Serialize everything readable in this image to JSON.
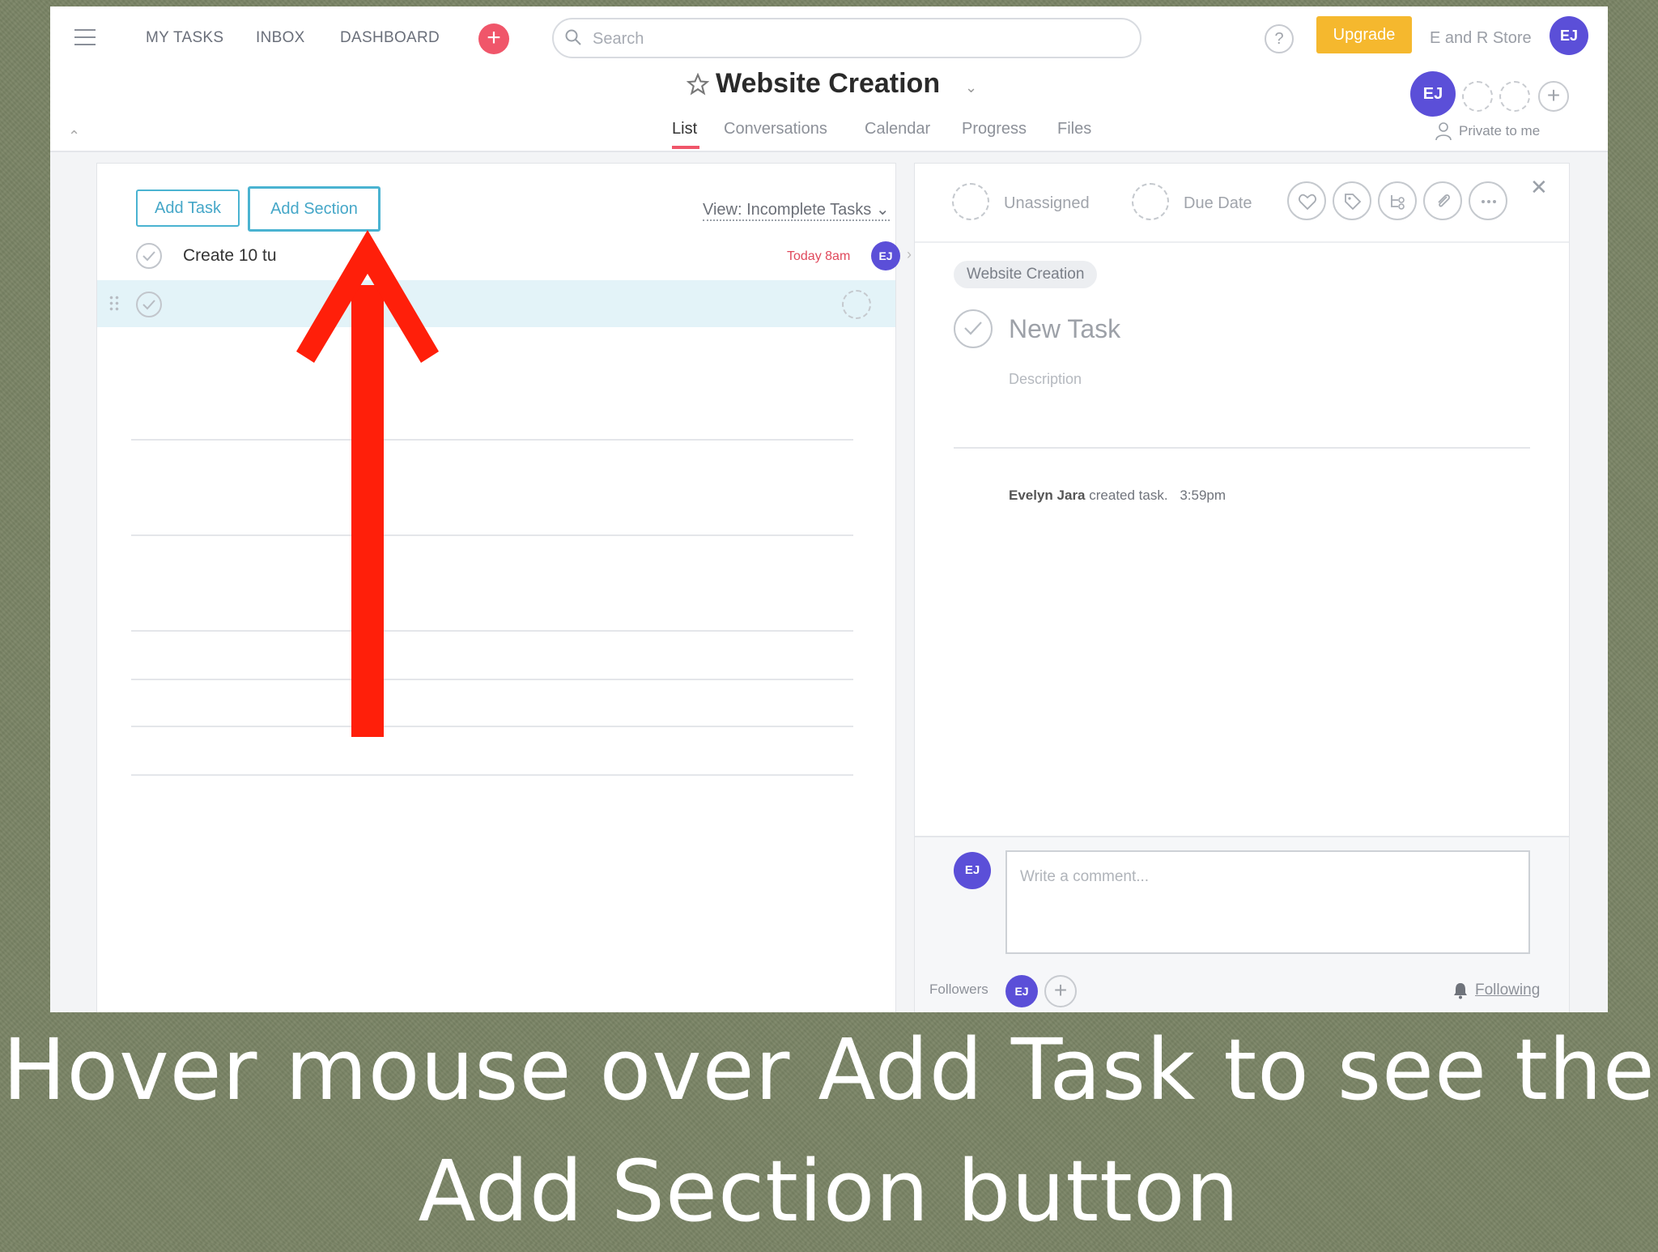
{
  "topbar": {
    "nav": [
      "MY TASKS",
      "INBOX",
      "DASHBOARD"
    ],
    "search_placeholder": "Search",
    "help_label": "?",
    "upgrade_label": "Upgrade",
    "org_name": "E and R Store",
    "user_initials": "EJ"
  },
  "project": {
    "title": "Website Creation",
    "tabs": [
      "List",
      "Conversations",
      "Calendar",
      "Progress",
      "Files"
    ],
    "active_tab": "List",
    "member_initials": "EJ",
    "privacy": "Private to me"
  },
  "list": {
    "add_task_label": "Add Task",
    "add_section_label": "Add Section",
    "view_filter": "View: Incomplete Tasks",
    "tasks": [
      {
        "name": "Create 10 tu",
        "due": "Today 8am",
        "assignee": "EJ"
      },
      {
        "name": "",
        "due": "",
        "assignee": ""
      }
    ]
  },
  "detail": {
    "assignee": "Unassigned",
    "due_date": "Due Date",
    "project_tag": "Website Creation",
    "task_title": "New Task",
    "description_placeholder": "Description",
    "activity_user": "Evelyn Jara",
    "activity_text": "created task.",
    "activity_time": "3:59pm",
    "comment_initials": "EJ",
    "comment_placeholder": "Write a comment...",
    "followers_label": "Followers",
    "follower_initials": "EJ",
    "following_label": "Following"
  },
  "caption": {
    "line1": "Hover mouse over Add Task to see the",
    "line2": "Add Section button"
  },
  "colors": {
    "accent_red": "#f0566a",
    "upgrade_yellow": "#f5b82e",
    "avatar_purple": "#5b4fd8",
    "button_blue": "#45a7c8",
    "annotation_arrow": "#ff1f0a",
    "background": "#7b8566"
  }
}
